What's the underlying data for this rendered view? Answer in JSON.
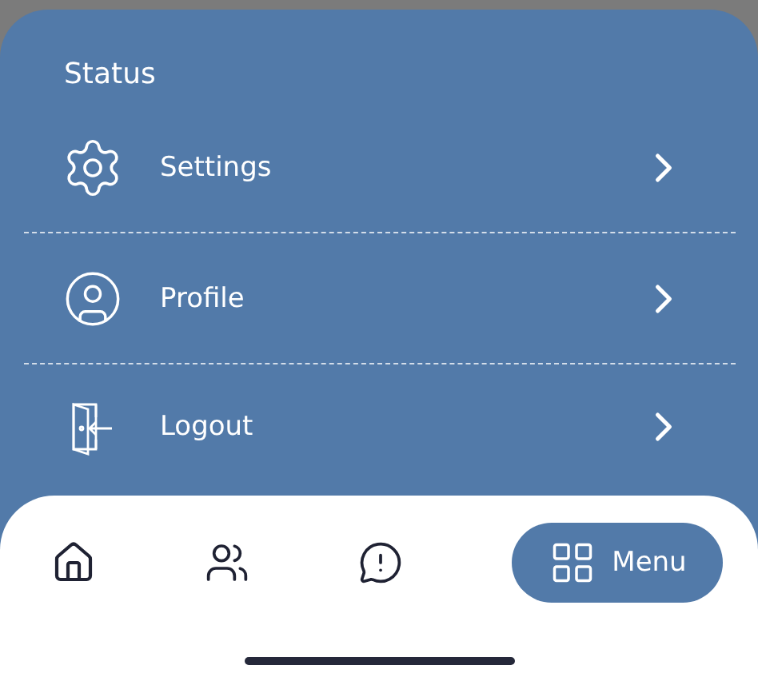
{
  "section_title": "Status",
  "menu_items": [
    {
      "label": "Settings"
    },
    {
      "label": "Profile"
    },
    {
      "label": "Logout"
    }
  ],
  "bottom_nav": [
    {
      "kind": "icon",
      "selected": false
    },
    {
      "kind": "icon",
      "selected": false
    },
    {
      "kind": "icon",
      "selected": false
    },
    {
      "kind": "pill",
      "label": "Menu",
      "selected": true
    }
  ]
}
